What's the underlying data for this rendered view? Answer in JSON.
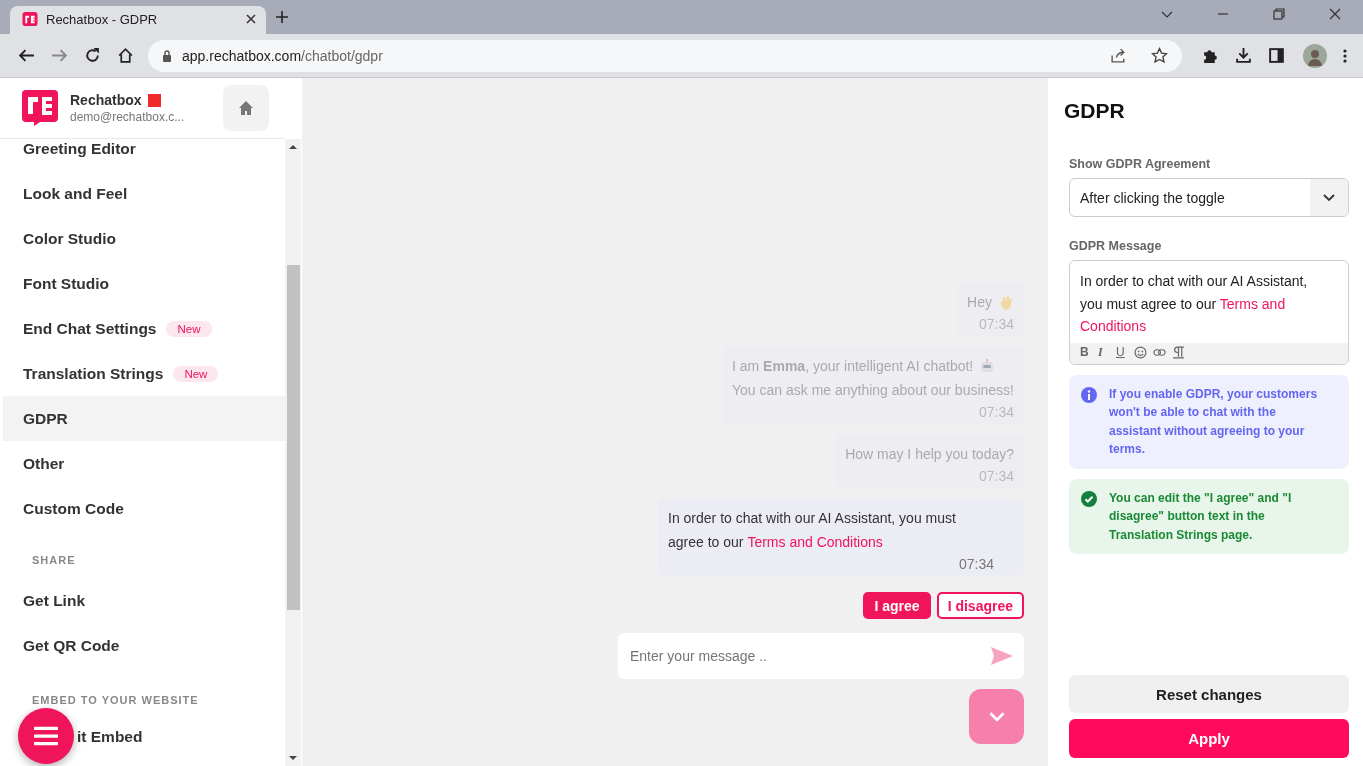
{
  "browser": {
    "tab_title": "Rechatbox - GDPR",
    "url_host": "app.rechatbox.com",
    "url_path": "/chatbot/gdpr"
  },
  "sidebar": {
    "brand": "Rechatbox",
    "email": "demo@rechatbox.c...",
    "items": [
      {
        "kind": "item",
        "label": "Greeting Editor",
        "selected": false
      },
      {
        "kind": "item",
        "label": "Look and Feel",
        "selected": false
      },
      {
        "kind": "item",
        "label": "Color Studio",
        "selected": false
      },
      {
        "kind": "item",
        "label": "Font Studio",
        "selected": false
      },
      {
        "kind": "item",
        "label": "End Chat Settings",
        "badge": "New",
        "selected": false
      },
      {
        "kind": "item",
        "label": "Translation Strings",
        "badge": "New",
        "selected": false
      },
      {
        "kind": "item",
        "label": "GDPR",
        "selected": true
      },
      {
        "kind": "item",
        "label": "Other",
        "selected": false
      },
      {
        "kind": "item",
        "label": "Custom Code",
        "selected": false
      },
      {
        "kind": "heading",
        "label": "SHARE"
      },
      {
        "kind": "item",
        "label": "Get Link",
        "selected": false
      },
      {
        "kind": "item",
        "label": "Get QR Code",
        "selected": false
      },
      {
        "kind": "heading",
        "label": "EMBED TO YOUR WEBSITE"
      },
      {
        "kind": "covered",
        "label": "it Embed",
        "selected": false
      }
    ]
  },
  "chat": {
    "messages": [
      {
        "faded": true,
        "kind": "wave",
        "text": "Hey",
        "time": "07:34"
      },
      {
        "faded": true,
        "kind": "robot",
        "text": "I am **Emma**, your intelligent AI chatbot!",
        "text2": "You can ask me anything about our business!",
        "time": "07:34"
      },
      {
        "faded": true,
        "text": "How may I help you today?",
        "time": "07:34"
      },
      {
        "faded": false,
        "text": "In order to chat with our AI Assistant, you must agree to our",
        "link": "Terms and Conditions",
        "time": "07:34"
      }
    ],
    "buttons": [
      {
        "label": "I agree",
        "kind": "primary"
      },
      {
        "label": "I disagree",
        "kind": "outline"
      }
    ],
    "input": {
      "placeholder": "Enter your message .."
    }
  },
  "panel": {
    "title": "GDPR",
    "show_label": "Show GDPR Agreement",
    "show_value": "After clicking the toggle",
    "message_label": "GDPR Message",
    "message": "In order to chat with our AI Assistant, you must agree to our",
    "message_link": "Terms and Conditions",
    "toolbar": [
      "B",
      "I",
      "U"
    ],
    "alerts": [
      {
        "kind": "info",
        "text": "If you enable GDPR, your customers won't be able to chat with the assistant without agreeing to your terms."
      },
      {
        "kind": "success",
        "text": "You can edit the \"I agree\" and \"I disagree\" button text in the Translation Strings page."
      }
    ],
    "reset": "Reset changes",
    "apply": "Apply"
  }
}
